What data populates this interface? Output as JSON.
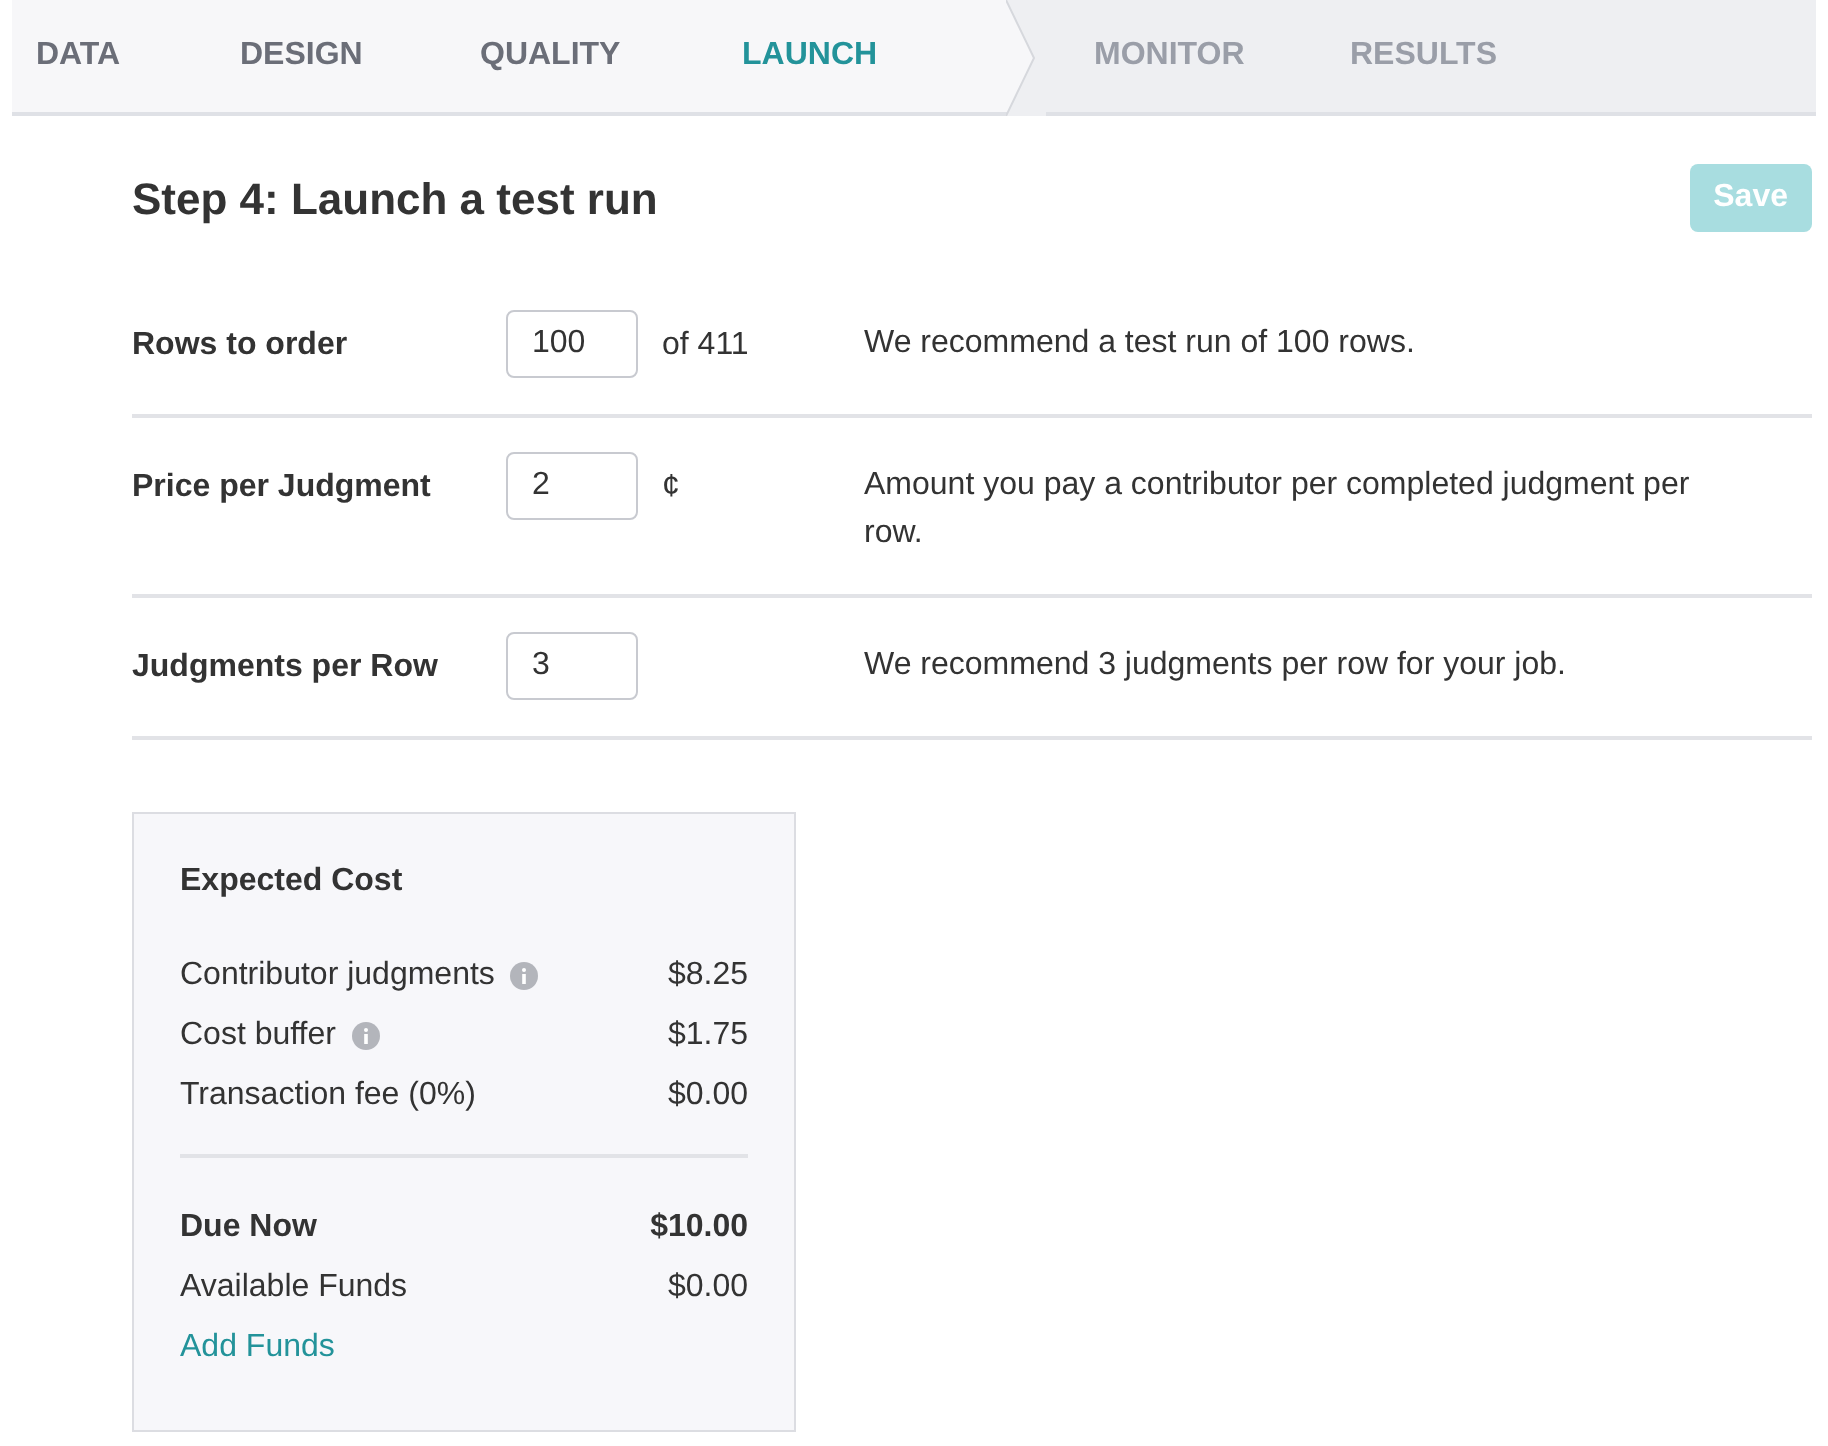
{
  "tabs": [
    {
      "label": "DATA",
      "selected": false,
      "disabled": false
    },
    {
      "label": "DESIGN",
      "selected": false,
      "disabled": false
    },
    {
      "label": "QUALITY",
      "selected": false,
      "disabled": false
    },
    {
      "label": "LAUNCH",
      "selected": true,
      "disabled": false
    },
    {
      "label": "MONITOR",
      "selected": false,
      "disabled": true
    },
    {
      "label": "RESULTS",
      "selected": false,
      "disabled": true
    }
  ],
  "heading": "Step 4: Launch a test run",
  "save_button": {
    "label": "Save",
    "disabled": true
  },
  "settings": [
    {
      "label": "Rows to order",
      "value": "100",
      "suffix": "of 411",
      "note": "We recommend a test run of 100 rows."
    },
    {
      "label": "Price per Judgment",
      "value": "2",
      "suffix": "¢",
      "note": "Amount you pay a contributor per completed judgment per row."
    },
    {
      "label": "Judgments per Row",
      "value": "3",
      "note": "We recommend 3 judgments per row for your job."
    }
  ],
  "cost": {
    "title": "Expected Cost",
    "lines": [
      {
        "label": "Contributor judgments",
        "info": true,
        "amount": "$8.25"
      },
      {
        "label": "Cost buffer",
        "info": true,
        "amount": "$1.75"
      },
      {
        "label": "Transaction fee (0%)",
        "info": false,
        "amount": "$0.00"
      }
    ],
    "totals": [
      {
        "label": "Due Now",
        "amount": "$10.00",
        "bold": true
      },
      {
        "label": "Available Funds",
        "amount": "$0.00",
        "bold": false
      }
    ],
    "link": "Add Funds"
  }
}
